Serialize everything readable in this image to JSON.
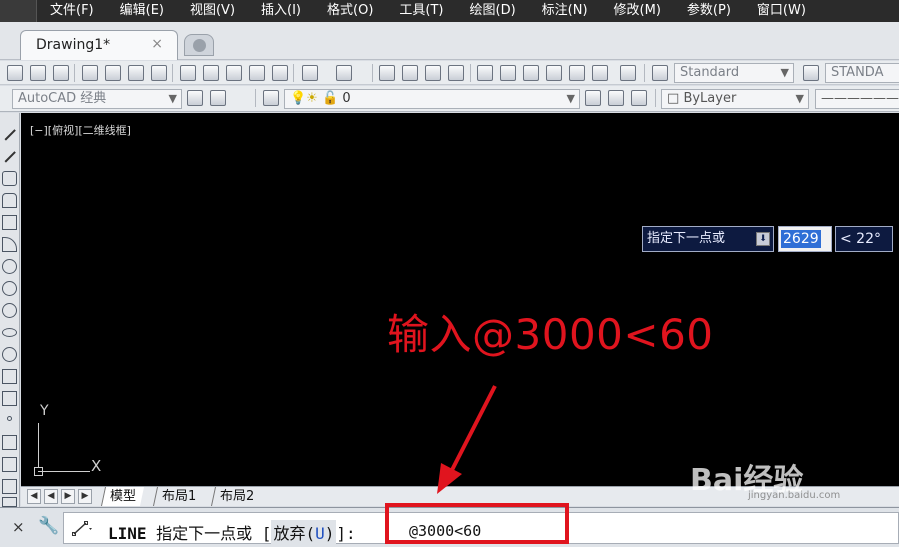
{
  "menu": [
    "文件(F)",
    "编辑(E)",
    "视图(V)",
    "插入(I)",
    "格式(O)",
    "工具(T)",
    "绘图(D)",
    "标注(N)",
    "修改(M)",
    "参数(P)",
    "窗口(W)"
  ],
  "tab": {
    "title": "Drawing1*",
    "close": "×"
  },
  "toolbar": {
    "text_style": "Standard",
    "dim_style": "STANDA",
    "workspace": "AutoCAD 经典",
    "layer": "0",
    "color": "ByLayer",
    "linetype": "By"
  },
  "viewport": {
    "label": "[−][俯视][二维线框]"
  },
  "dynamic_input": {
    "prompt": "指定下一点或",
    "length": "2629",
    "angle": "< 22°"
  },
  "annotation": "输入@3000<60",
  "ucs": {
    "y": "Y",
    "x": "X"
  },
  "layout_tabs": [
    "模型",
    "布局1",
    "布局2"
  ],
  "command_line": {
    "close": "×",
    "command": "LINE",
    "prompt": "指定下一点或 [",
    "option_label": "放弃(",
    "option_key": "U",
    "option_close": ")",
    "prompt_end": "]:",
    "value": "@3000<60"
  },
  "watermark": {
    "text": "Bai经验",
    "sub": "jingyan.baidu.com"
  },
  "colors": {
    "annotation_red": "#e0141e",
    "canvas_bg": "#000000",
    "dyn_input_bg": "#0d1a40"
  }
}
